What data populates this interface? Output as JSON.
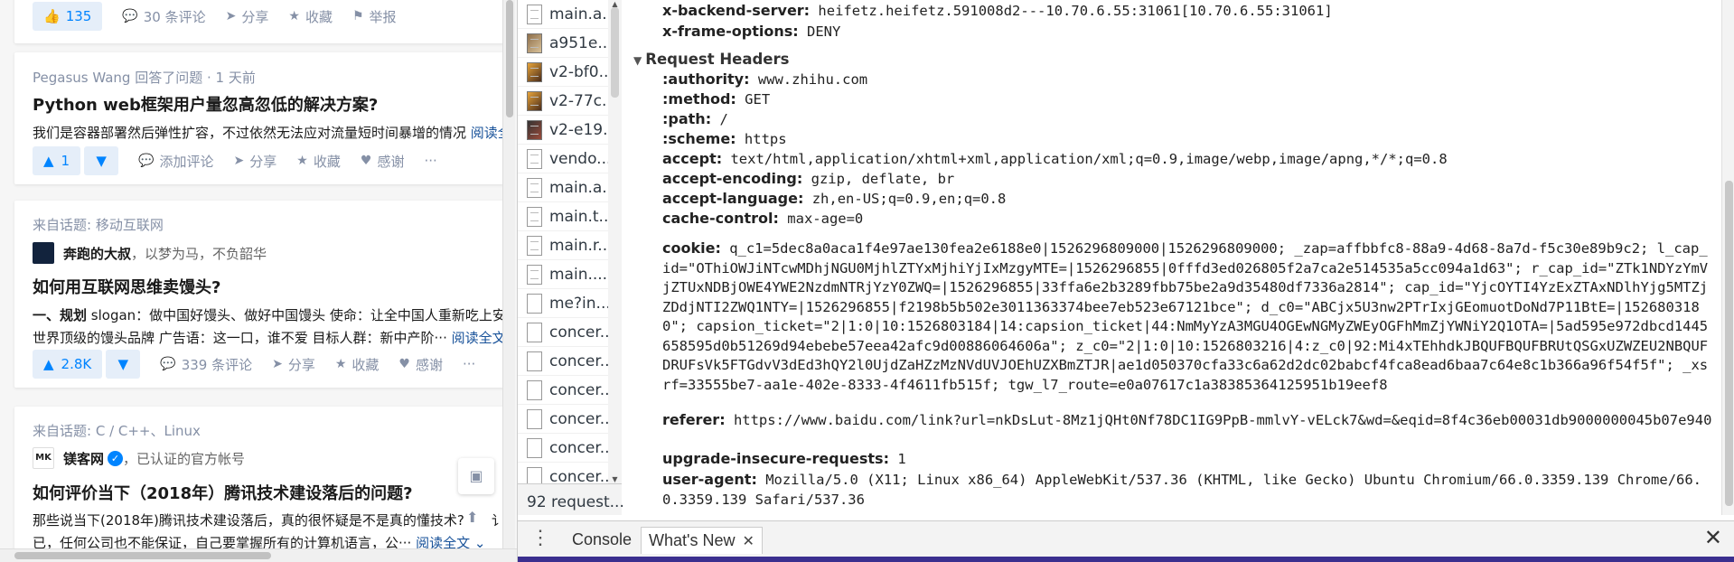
{
  "feed": {
    "cards": [
      {
        "actions": {
          "vote_up": "135",
          "comments": "30 条评论",
          "share": "分享",
          "favorite": "收藏",
          "report": "举报"
        }
      },
      {
        "source": "Pegasus Wang 回答了问题 · 1 天前",
        "title": "Python web框架用户量忽高忽低的解决方案?",
        "excerpt": "我们是容器部署然后弹性扩容，不过依然无法应对流量短时间暴增的情况",
        "read_more": "阅读全",
        "actions": {
          "vote_up": "1",
          "comments": "添加评论",
          "share": "分享",
          "favorite": "收藏",
          "thanks": "感谢",
          "more": "···"
        }
      },
      {
        "source": "来自话题: 移动互联网",
        "author": "奔跑的大叔",
        "author_bio": "，以梦为马，不负韶华",
        "title": "如何用互联网思维卖馒头?",
        "excerpt_line1_bold": "一、规划",
        "excerpt_line1": " slogan：做中国好馒头、做好中国馒头 使命：让全中国人重新吃上安心",
        "excerpt_line2": "世界顶级的馒头品牌 广告语：这一口，谁不爱 目标人群：新中产阶···",
        "read_more": "阅读全文",
        "actions": {
          "vote_up": "2.8K",
          "comments": "339 条评论",
          "share": "分享",
          "favorite": "收藏",
          "thanks": "感谢",
          "more": "···"
        }
      },
      {
        "source": "来自话题: C / C++、Linux",
        "author": "镁客网",
        "author_bio": "，已认证的官方帐号",
        "title": "如何评价当下（2018年）腾讯技术建设落后的问题?",
        "excerpt_line1": "那些说当下(2018年)腾讯技术建设落后，真的很怀疑是不是真的懂技术?",
        "excerpt_line1_tail": "讠",
        "excerpt_line2": "已，任何公司也不能保证，自己要掌握所有的计算机语言，公···",
        "read_more": "阅读全文"
      }
    ]
  },
  "devtools": {
    "requests": [
      {
        "name": "main.a...",
        "icon": "file"
      },
      {
        "name": "a951e...",
        "icon": "img"
      },
      {
        "name": "v2-bf0...",
        "icon": "img2"
      },
      {
        "name": "v2-77c...",
        "icon": "img2"
      },
      {
        "name": "v2-e19...",
        "icon": "img3"
      },
      {
        "name": "vendo...",
        "icon": "file"
      },
      {
        "name": "main.a...",
        "icon": "file"
      },
      {
        "name": "main.t...",
        "icon": "file"
      },
      {
        "name": "main.r...",
        "icon": "file"
      },
      {
        "name": "main....",
        "icon": "file"
      },
      {
        "name": "me?in...",
        "icon": "blank"
      },
      {
        "name": "concer...",
        "icon": "blank"
      },
      {
        "name": "concer...",
        "icon": "blank"
      },
      {
        "name": "concer...",
        "icon": "blank"
      },
      {
        "name": "concer...",
        "icon": "blank"
      },
      {
        "name": "concer...",
        "icon": "blank"
      },
      {
        "name": "concer...",
        "icon": "blank"
      }
    ],
    "request_count": "92 request...",
    "response_headers_tail": [
      {
        "name": "x-backend-server:",
        "value": "heifetz.heifetz.591008d2---10.70.6.55:31061[10.70.6.55:31061]"
      },
      {
        "name": "x-frame-options:",
        "value": "DENY"
      }
    ],
    "request_headers_title": "Request Headers",
    "request_headers": [
      {
        "name": ":authority:",
        "value": "www.zhihu.com"
      },
      {
        "name": ":method:",
        "value": "GET"
      },
      {
        "name": ":path:",
        "value": "/"
      },
      {
        "name": ":scheme:",
        "value": "https"
      },
      {
        "name": "accept:",
        "value": "text/html,application/xhtml+xml,application/xml;q=0.9,image/webp,image/apng,*/*;q=0.8"
      },
      {
        "name": "accept-encoding:",
        "value": "gzip, deflate, br"
      },
      {
        "name": "accept-language:",
        "value": "zh,en-US;q=0.9,en;q=0.8"
      },
      {
        "name": "cache-control:",
        "value": "max-age=0"
      }
    ],
    "cookie": {
      "name": "cookie:",
      "value": "q_c1=5dec8a0aca1f4e97ae130fea2e6188e0|1526296809000|1526296809000; _zap=affbbfc8-88a9-4d68-8a7d-f5c30e89b9c2; l_cap_id=\"OThiOWJiNTcwMDhjNGU0MjhlZTYxMjhiYjIxMzgyMTE=|1526296855|0fffd3ed026805f2a7ca2e514535a5cc094a1d63\"; r_cap_id=\"ZTk1NDYzYmVjZTUxNDBjOWE4YWE2NzdmNTRjYzY0ZWQ=|1526296855|33ffa6e2b3289fbb75be2a9d35480df7336a2814\"; cap_id=\"YjcOYTI4YzExZTAxNDlhYjg5MTZjZDdjNTI2ZWQ1NTY=|1526296855|f2198b5b502e3011363374bee7eb523e67121bce\"; d_c0=\"ABCjx5U3nw2PTrIxjGEomuotDoNd7P11BtE=|1526803180\"; capsion_ticket=\"2|1:0|10:1526803184|14:capsion_ticket|44:NmMyYzA3MGU4OGEwNGMyZWEyOGFhMmZjYWNiY2Q1OTA=|5ad595e972dbcd1445658595d0b51269d94ebebe57eea42afc9d00886064606a\"; z_c0=\"2|1:0|10:1526803216|4:z_c0|92:Mi4xTEhhdkJBQUFBQUFBRUtQSGxUZWZEU2NBQUFDRUFsVk5FTGdvV3dEd3hQY2l0UjdZaHZzMzNVdUVJOEhUZXBmZTJR|ae1d050370cfa33c6a62d2dc02babcf4fca8ead6baa7c64e8c1b366a96f54f5f\"; _xsrf=33555be7-aa1e-402e-8333-4f4611fb515f; tgw_l7_route=e0a07617c1a38385364125951b19eef8"
    },
    "referer": {
      "name": "referer:",
      "value": "https://www.baidu.com/link?url=nkDsLut-8Mz1jQHt0Nf78DC1IG9PpB-mmlvY-vELck7&wd=&eqid=8f4c36eb00031db9000000045b07e940"
    },
    "upgrade": {
      "name": "upgrade-insecure-requests:",
      "value": "1"
    },
    "user_agent": {
      "name": "user-agent:",
      "value": "Mozilla/5.0 (X11; Linux x86_64) AppleWebKit/537.36 (KHTML, like Gecko) Ubuntu Chromium/66.0.3359.139 Chrome/66.0.3359.139 Safari/537.36"
    },
    "drawer": {
      "tab_console": "Console",
      "tab_whats_new": "What's New",
      "close_tab": "✕",
      "close_drawer": "✕",
      "menu": "⋮"
    }
  },
  "icons": {
    "accent": "#0084ff",
    "devtools_accent": "#3b2f8f"
  }
}
